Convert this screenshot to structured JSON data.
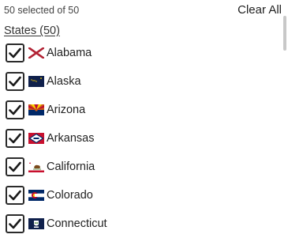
{
  "header": {
    "selection_count": "50 selected of 50",
    "clear_all_label": "Clear All"
  },
  "group": {
    "title": "States (50)"
  },
  "states": [
    {
      "name": "Alabama",
      "checked": true,
      "flag_icon": "alabama-flag-icon"
    },
    {
      "name": "Alaska",
      "checked": true,
      "flag_icon": "alaska-flag-icon"
    },
    {
      "name": "Arizona",
      "checked": true,
      "flag_icon": "arizona-flag-icon"
    },
    {
      "name": "Arkansas",
      "checked": true,
      "flag_icon": "arkansas-flag-icon"
    },
    {
      "name": "California",
      "checked": true,
      "flag_icon": "california-flag-icon"
    },
    {
      "name": "Colorado",
      "checked": true,
      "flag_icon": "colorado-flag-icon"
    },
    {
      "name": "Connecticut",
      "checked": true,
      "flag_icon": "connecticut-flag-icon"
    }
  ]
}
